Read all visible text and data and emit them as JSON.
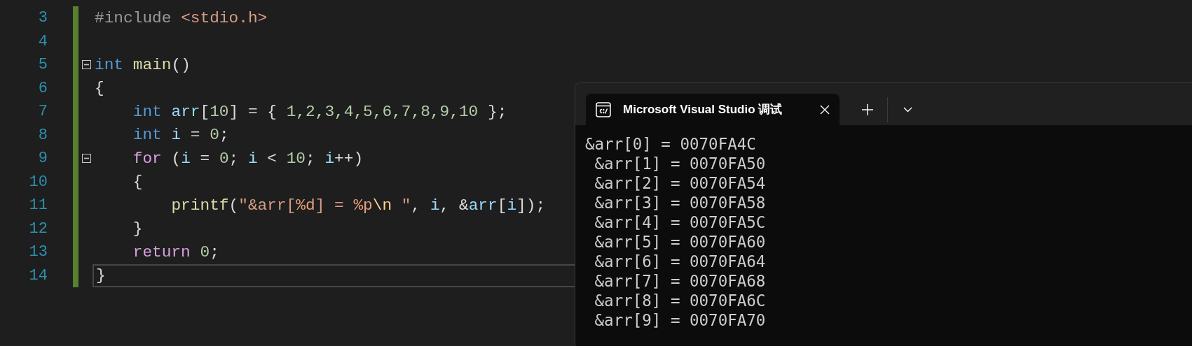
{
  "editor": {
    "lines": [
      {
        "number": "3",
        "foldable": false,
        "changed": true,
        "current": false,
        "tokens": [
          {
            "kind": "preproc",
            "text": "#include "
          },
          {
            "kind": "string",
            "text": "<stdio.h>"
          }
        ]
      },
      {
        "number": "4",
        "foldable": false,
        "changed": true,
        "current": false
      },
      {
        "number": "5",
        "foldable": true,
        "changed": true,
        "current": false,
        "tokens": [
          {
            "kind": "keyword",
            "text": "int "
          },
          {
            "kind": "function",
            "text": "main"
          },
          {
            "kind": "plain",
            "text": "()"
          }
        ]
      },
      {
        "number": "6",
        "foldable": false,
        "changed": true,
        "current": false,
        "tokens": [
          {
            "kind": "plain",
            "text": "{"
          }
        ]
      },
      {
        "number": "7",
        "foldable": false,
        "changed": true,
        "current": false,
        "tokens": [
          {
            "kind": "keyword",
            "text": "    int "
          },
          {
            "kind": "variable",
            "text": "arr"
          },
          {
            "kind": "plain",
            "text": "["
          },
          {
            "kind": "number",
            "text": "10"
          },
          {
            "kind": "plain",
            "text": "] = { "
          },
          {
            "kind": "number",
            "text": "1,2,3,4,5,6,7,8,9,10"
          },
          {
            "kind": "plain",
            "text": " };"
          }
        ]
      },
      {
        "number": "8",
        "foldable": false,
        "changed": true,
        "current": false,
        "tokens": [
          {
            "kind": "keyword",
            "text": "    int "
          },
          {
            "kind": "variable",
            "text": "i"
          },
          {
            "kind": "plain",
            "text": " = "
          },
          {
            "kind": "number",
            "text": "0"
          },
          {
            "kind": "plain",
            "text": ";"
          }
        ]
      },
      {
        "number": "9",
        "foldable": true,
        "changed": true,
        "current": false,
        "tokens": [
          {
            "kind": "control",
            "text": "    for"
          },
          {
            "kind": "plain",
            "text": " ("
          },
          {
            "kind": "variable",
            "text": "i"
          },
          {
            "kind": "plain",
            "text": " = "
          },
          {
            "kind": "number",
            "text": "0"
          },
          {
            "kind": "plain",
            "text": "; "
          },
          {
            "kind": "variable",
            "text": "i"
          },
          {
            "kind": "plain",
            "text": " < "
          },
          {
            "kind": "number",
            "text": "10"
          },
          {
            "kind": "plain",
            "text": "; "
          },
          {
            "kind": "variable",
            "text": "i"
          },
          {
            "kind": "plain",
            "text": "++)"
          }
        ]
      },
      {
        "number": "10",
        "foldable": false,
        "changed": true,
        "current": false,
        "tokens": [
          {
            "kind": "plain",
            "text": "    {"
          }
        ]
      },
      {
        "number": "11",
        "foldable": false,
        "changed": true,
        "current": false,
        "tokens": [
          {
            "kind": "function",
            "text": "        printf"
          },
          {
            "kind": "plain",
            "text": "("
          },
          {
            "kind": "string",
            "text": "\"&arr["
          },
          {
            "kind": "format",
            "text": "%d"
          },
          {
            "kind": "string",
            "text": "] = "
          },
          {
            "kind": "format",
            "text": "%p"
          },
          {
            "kind": "escape",
            "text": "\\n"
          },
          {
            "kind": "string",
            "text": " \""
          },
          {
            "kind": "plain",
            "text": ", "
          },
          {
            "kind": "variable",
            "text": "i"
          },
          {
            "kind": "plain",
            "text": ", &"
          },
          {
            "kind": "variable",
            "text": "arr"
          },
          {
            "kind": "plain",
            "text": "["
          },
          {
            "kind": "variable",
            "text": "i"
          },
          {
            "kind": "plain",
            "text": "]);"
          }
        ]
      },
      {
        "number": "12",
        "foldable": false,
        "changed": true,
        "current": false,
        "tokens": [
          {
            "kind": "plain",
            "text": "    }"
          }
        ]
      },
      {
        "number": "13",
        "foldable": false,
        "changed": true,
        "current": false,
        "tokens": [
          {
            "kind": "control",
            "text": "    return "
          },
          {
            "kind": "number",
            "text": "0"
          },
          {
            "kind": "plain",
            "text": ";"
          }
        ]
      },
      {
        "number": "14",
        "foldable": false,
        "changed": true,
        "current": true,
        "tokens": [
          {
            "kind": "plain",
            "text": "}"
          }
        ]
      }
    ]
  },
  "terminal": {
    "tabs": [
      {
        "title": "Microsoft Visual Studio 调试",
        "selected": true
      }
    ],
    "output": [
      "&arr[0] = 0070FA4C",
      " &arr[1] = 0070FA50",
      " &arr[2] = 0070FA54",
      " &arr[3] = 0070FA58",
      " &arr[4] = 0070FA5C",
      " &arr[5] = 0070FA60",
      " &arr[6] = 0070FA64",
      " &arr[7] = 0070FA68",
      " &arr[8] = 0070FA6C",
      " &arr[9] = 0070FA70"
    ]
  }
}
